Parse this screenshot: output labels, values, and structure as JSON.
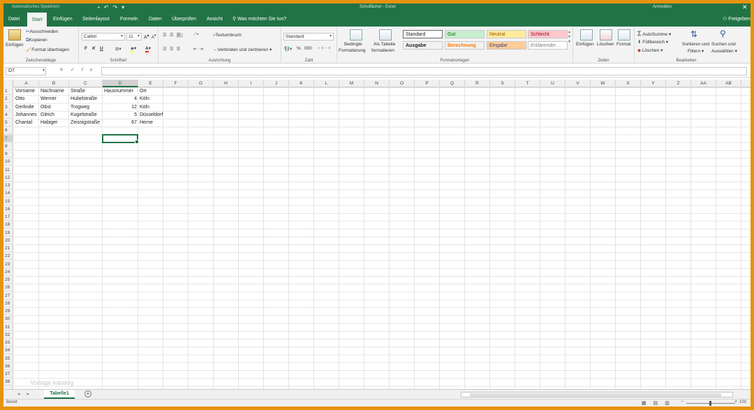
{
  "titlebar": {
    "autosave": "Automatisches Speichern",
    "title": "Schulfächer - Excel",
    "user": "Anmelden",
    "close": "✕"
  },
  "tabs": [
    "Datei",
    "Start",
    "Einfügen",
    "Seitenlayout",
    "Formeln",
    "Daten",
    "Überprüfen",
    "Ansicht"
  ],
  "active_tab": "Start",
  "tell_me": "Was möchten Sie tun?",
  "share": "Freigeben",
  "ribbon": {
    "clipboard": {
      "label": "Zwischenablage",
      "paste": "Einfügen",
      "cut": "Ausschneiden",
      "copy": "Kopieren",
      "format_painter": "Format übertragen"
    },
    "font": {
      "label": "Schriftart",
      "name": "Calibri",
      "size": "11",
      "bold": "F",
      "italic": "K",
      "underline": "U"
    },
    "alignment": {
      "label": "Ausrichtung",
      "wrap": "Textumbruch",
      "merge": "Verbinden und zentrieren"
    },
    "number": {
      "label": "Zahl",
      "format": "Standard",
      "percent": "%",
      "thousands": "000"
    },
    "styles": {
      "label": "Formatvorlagen",
      "conditional_1": "Bedingte",
      "conditional_2": "Formatierung",
      "as_table_1": "Als Tabelle",
      "as_table_2": "formatieren",
      "items": [
        {
          "name": "Standard",
          "bg": "#ffffff",
          "color": "#222222"
        },
        {
          "name": "Gut",
          "bg": "#c6efce",
          "color": "#006100"
        },
        {
          "name": "Neutral",
          "bg": "#ffeb9c",
          "color": "#9c5700"
        },
        {
          "name": "Schlecht",
          "bg": "#ffc7ce",
          "color": "#9c0006"
        },
        {
          "name": "Ausgabe",
          "bg": "#f2f2f2",
          "color": "#222222"
        },
        {
          "name": "Berechnung",
          "bg": "#f2f2f2",
          "color": "#fa7d00"
        },
        {
          "name": "Eingabe",
          "bg": "#ffcc99",
          "color": "#3f3f76"
        },
        {
          "name": "Erklärender ...",
          "bg": "#ffffff",
          "color": "#7f7f7f"
        }
      ]
    },
    "cells": {
      "label": "Zellen",
      "insert": "Einfügen",
      "delete": "Löschen",
      "format": "Format"
    },
    "editing": {
      "label": "Bearbeiten",
      "autosum": "AutoSumme",
      "fill": "Füllbereich",
      "clear": "Löschen",
      "sort_1": "Sortieren und",
      "sort_2": "Filtern",
      "find_1": "Suchen und",
      "find_2": "Auswählen"
    }
  },
  "formula_bar": {
    "name_box": "D7",
    "cancel": "✕",
    "enter": "✓",
    "fx": "fx",
    "value": ""
  },
  "columns": [
    "A",
    "B",
    "C",
    "D",
    "E",
    "F",
    "G",
    "H",
    "I",
    "J",
    "K",
    "L",
    "M",
    "N",
    "O",
    "P",
    "Q",
    "R",
    "S",
    "T",
    "U",
    "V",
    "W",
    "X",
    "Y",
    "Z",
    "AA",
    "AB"
  ],
  "selected_column": "D",
  "selected_row": 7,
  "row_count": 38,
  "sheet": {
    "rows": [
      [
        "Vorname",
        "Nachname",
        "Straße",
        "Hausnummer",
        "Ort"
      ],
      [
        "Otto",
        "Werner",
        "Hubelstraße",
        "4",
        "Köln"
      ],
      [
        "Gerlinde",
        "Obst",
        "Trogweg",
        "12",
        "Köln"
      ],
      [
        "Johannes",
        "Gleich",
        "Kugelstraße",
        "5",
        "Düsseldorf"
      ],
      [
        "Chantal",
        "Habiger",
        "Zeissigstraße",
        "67",
        "Herne"
      ]
    ]
  },
  "watermark": "Vorlage katalog",
  "sheet_tabs": {
    "active": "Tabelle1",
    "add": "+"
  },
  "status": {
    "ready": "Bereit",
    "zoom": "100"
  }
}
